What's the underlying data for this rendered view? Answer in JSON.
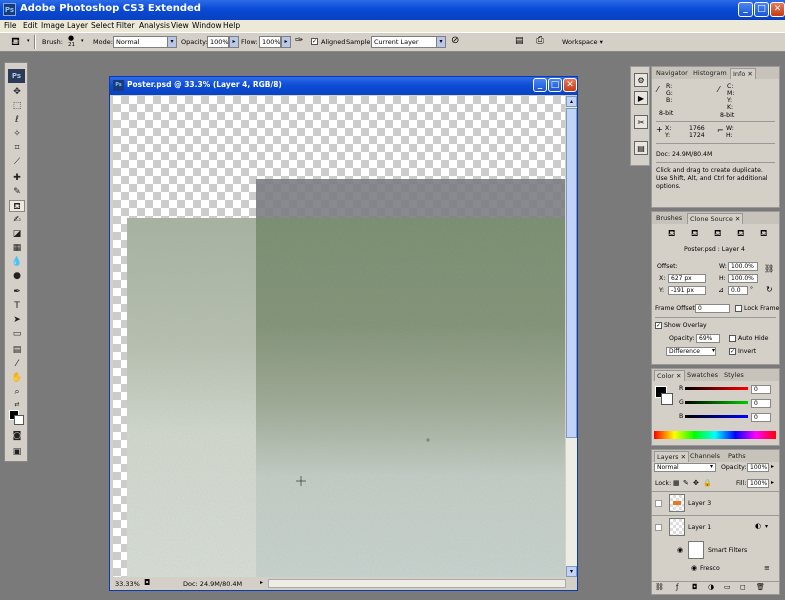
{
  "window": {
    "app_icon": "Ps",
    "title": "Adobe Photoshop CS3 Extended",
    "min": "_",
    "max": "□",
    "close": "✕"
  },
  "menu": [
    "File",
    "Edit",
    "Image",
    "Layer",
    "Select",
    "Filter",
    "Analysis",
    "View",
    "Window",
    "Help"
  ],
  "options": {
    "brush_label": "Brush:",
    "brush_size": "21",
    "mode_label": "Mode:",
    "mode_value": "Normal",
    "opacity_label": "Opacity:",
    "opacity_value": "100%",
    "flow_label": "Flow:",
    "flow_value": "100%",
    "aligned_label": "Aligned",
    "sample_label": "Sample:",
    "sample_value": "Current Layer",
    "workspace_label": "Workspace ▾"
  },
  "toolbox": {
    "logo": "Ps"
  },
  "document": {
    "icon": "Ps",
    "title": "Poster.psd @ 33.3% (Layer 4, RGB/8)",
    "zoom": "33.33%",
    "doc_size": "Doc: 24.9M/80.4M"
  },
  "info_panel": {
    "tabs": [
      "Navigator",
      "Histogram",
      "Info"
    ],
    "active_tab": "Info",
    "r": "R:",
    "g": "G:",
    "b": "B:",
    "c": "C:",
    "m": "M:",
    "y": "Y:",
    "k": "K:",
    "bit1": "8-bit",
    "bit2": "8-bit",
    "x_label": "X:",
    "x_value": "1766",
    "y_label": "Y:",
    "y_value": "1724",
    "w_label": "W:",
    "h_label": "H:",
    "doc": "Doc: 24.9M/80.4M",
    "hint": "Click and drag to create duplicate.  Use Shift, Alt, and Ctrl for additional options."
  },
  "clone_panel": {
    "tabs": [
      "Brushes",
      "Clone Source"
    ],
    "active_tab": "Clone Source",
    "source": "Poster.psd : Layer 4",
    "offset_label": "Offset:",
    "x_label": "X:",
    "x_value": "627 px",
    "y_label": "Y:",
    "y_value": "-191 px",
    "w_label": "W:",
    "w_value": "100.0%",
    "h_label": "H:",
    "h_value": "100.0%",
    "angle_value": "0.0",
    "angle_unit": "°",
    "frame_offset_label": "Frame Offset:",
    "frame_offset_value": "0",
    "lock_frame_label": "Lock Frame",
    "show_overlay_label": "Show Overlay",
    "opacity_label": "Opacity:",
    "opacity_value": "69%",
    "auto_hide_label": "Auto Hide",
    "blend_value": "Difference",
    "invert_label": "Invert"
  },
  "color_panel": {
    "tabs": [
      "Color",
      "Swatches",
      "Styles"
    ],
    "active_tab": "Color",
    "r_label": "R",
    "r_value": "0",
    "g_label": "G",
    "g_value": "0",
    "b_label": "B",
    "b_value": "0"
  },
  "layers_panel": {
    "tabs": [
      "Layers",
      "Channels",
      "Paths"
    ],
    "active_tab": "Layers",
    "blend_value": "Normal",
    "opacity_label": "Opacity:",
    "opacity_value": "100%",
    "lock_label": "Lock:",
    "fill_label": "Fill:",
    "fill_value": "100%",
    "layers": [
      {
        "name": "Layer 3"
      },
      {
        "name": "Layer 1"
      },
      {
        "name": "Smart Filters"
      },
      {
        "name": "Fresco"
      }
    ]
  }
}
